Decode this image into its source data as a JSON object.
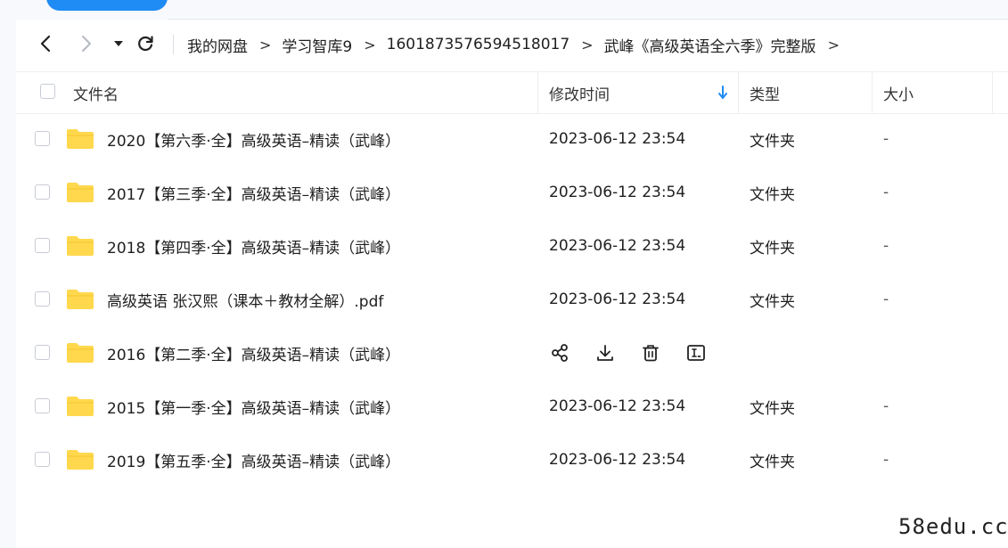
{
  "breadcrumb": [
    "我的网盘",
    "学习智库9",
    "1601873576594518017",
    "武峰《高级英语全六季》完整版"
  ],
  "breadcrumb_separator": ">",
  "columns": {
    "name": "文件名",
    "modified": "修改时间",
    "type": "类型",
    "size": "大小"
  },
  "sort": {
    "column": "modified",
    "direction": "descending",
    "indicator_color": "#1f8bf5"
  },
  "rows": [
    {
      "name": "2020【第六季·全】高级英语–精读（武峰）",
      "modified": "2023-06-12 23:54",
      "type": "文件夹",
      "size": "-",
      "icon": "folder-icon"
    },
    {
      "name": "2017【第三季·全】高级英语–精读（武峰）",
      "modified": "2023-06-12 23:54",
      "type": "文件夹",
      "size": "-",
      "icon": "folder-icon"
    },
    {
      "name": "2018【第四季·全】高级英语–精读（武峰）",
      "modified": "2023-06-12 23:54",
      "type": "文件夹",
      "size": "-",
      "icon": "folder-icon"
    },
    {
      "name": "高级英语 张汉熙（课本＋教材全解）.pdf",
      "modified": "2023-06-12 23:54",
      "type": "文件夹",
      "size": "-",
      "icon": "folder-icon"
    },
    {
      "name": "2016【第二季·全】高级英语–精读（武峰）",
      "modified": "",
      "type": "",
      "size": "",
      "icon": "folder-icon",
      "hovered": true,
      "actions": [
        "share-icon",
        "download-icon",
        "delete-icon",
        "rename-icon"
      ]
    },
    {
      "name": "2015【第一季·全】高级英语–精读（武峰）",
      "modified": "2023-06-12 23:54",
      "type": "文件夹",
      "size": "-",
      "icon": "folder-icon"
    },
    {
      "name": "2019【第五季·全】高级英语–精读（武峰）",
      "modified": "2023-06-12 23:54",
      "type": "文件夹",
      "size": "-",
      "icon": "folder-icon"
    }
  ],
  "watermark": "58edu.cc",
  "colors": {
    "accent": "#1f8bf5",
    "folder": "#ffd84d",
    "text": "#1f1f1f"
  }
}
